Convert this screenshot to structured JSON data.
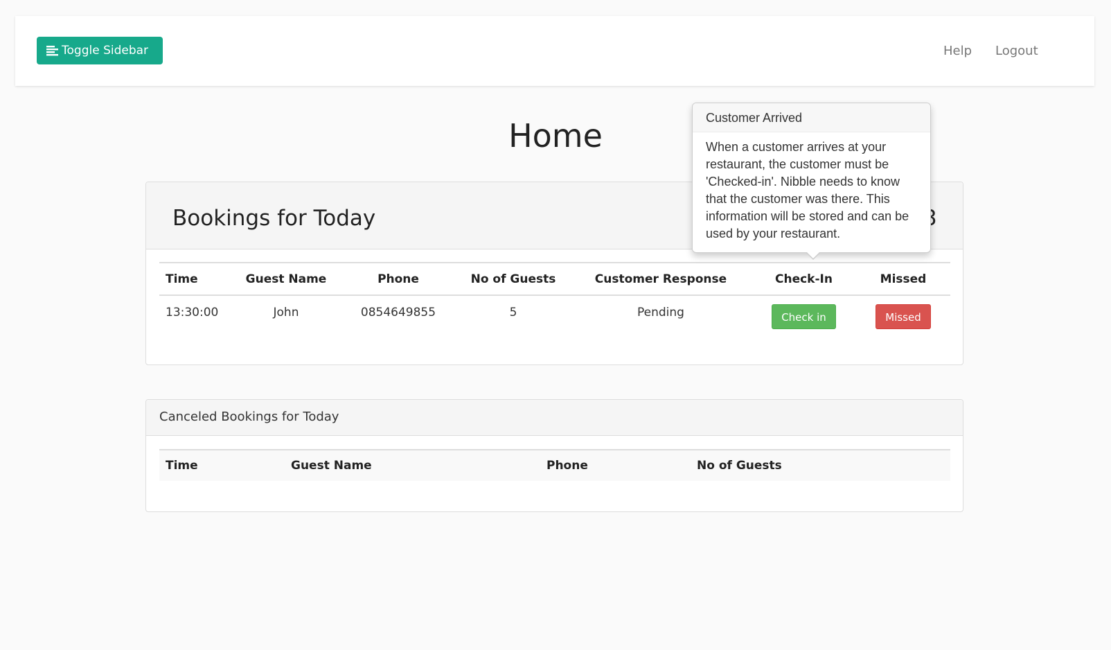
{
  "navbar": {
    "toggle_label": "Toggle Sidebar",
    "toggle_icon": "align-left-icon",
    "help_label": "Help",
    "logout_label": "Logout",
    "accent_color": "#17a98b"
  },
  "page": {
    "title": "Home"
  },
  "bookings": {
    "heading": "Bookings for Today",
    "partial_obscured_text": "3",
    "columns": [
      "Time",
      "Guest Name",
      "Phone",
      "No of Guests",
      "Customer Response",
      "Check-In",
      "Missed"
    ],
    "rows": [
      {
        "time": "13:30:00",
        "guest_name": "John",
        "phone": "0854649855",
        "guests": "5",
        "response": "Pending",
        "checkin_label": "Check in",
        "missed_label": "Missed"
      }
    ]
  },
  "canceled": {
    "heading": "Canceled Bookings for Today",
    "columns": [
      "Time",
      "Guest Name",
      "Phone",
      "No of Guests"
    ]
  },
  "popover": {
    "title": "Customer Arrived",
    "content": "When a customer arrives at your restaurant, the customer must be 'Checked-in'. Nibble needs to know that the customer was there. This information will be stored and can be used by your restaurant."
  },
  "colors": {
    "success": "#5cb85c",
    "danger": "#d9534f"
  }
}
